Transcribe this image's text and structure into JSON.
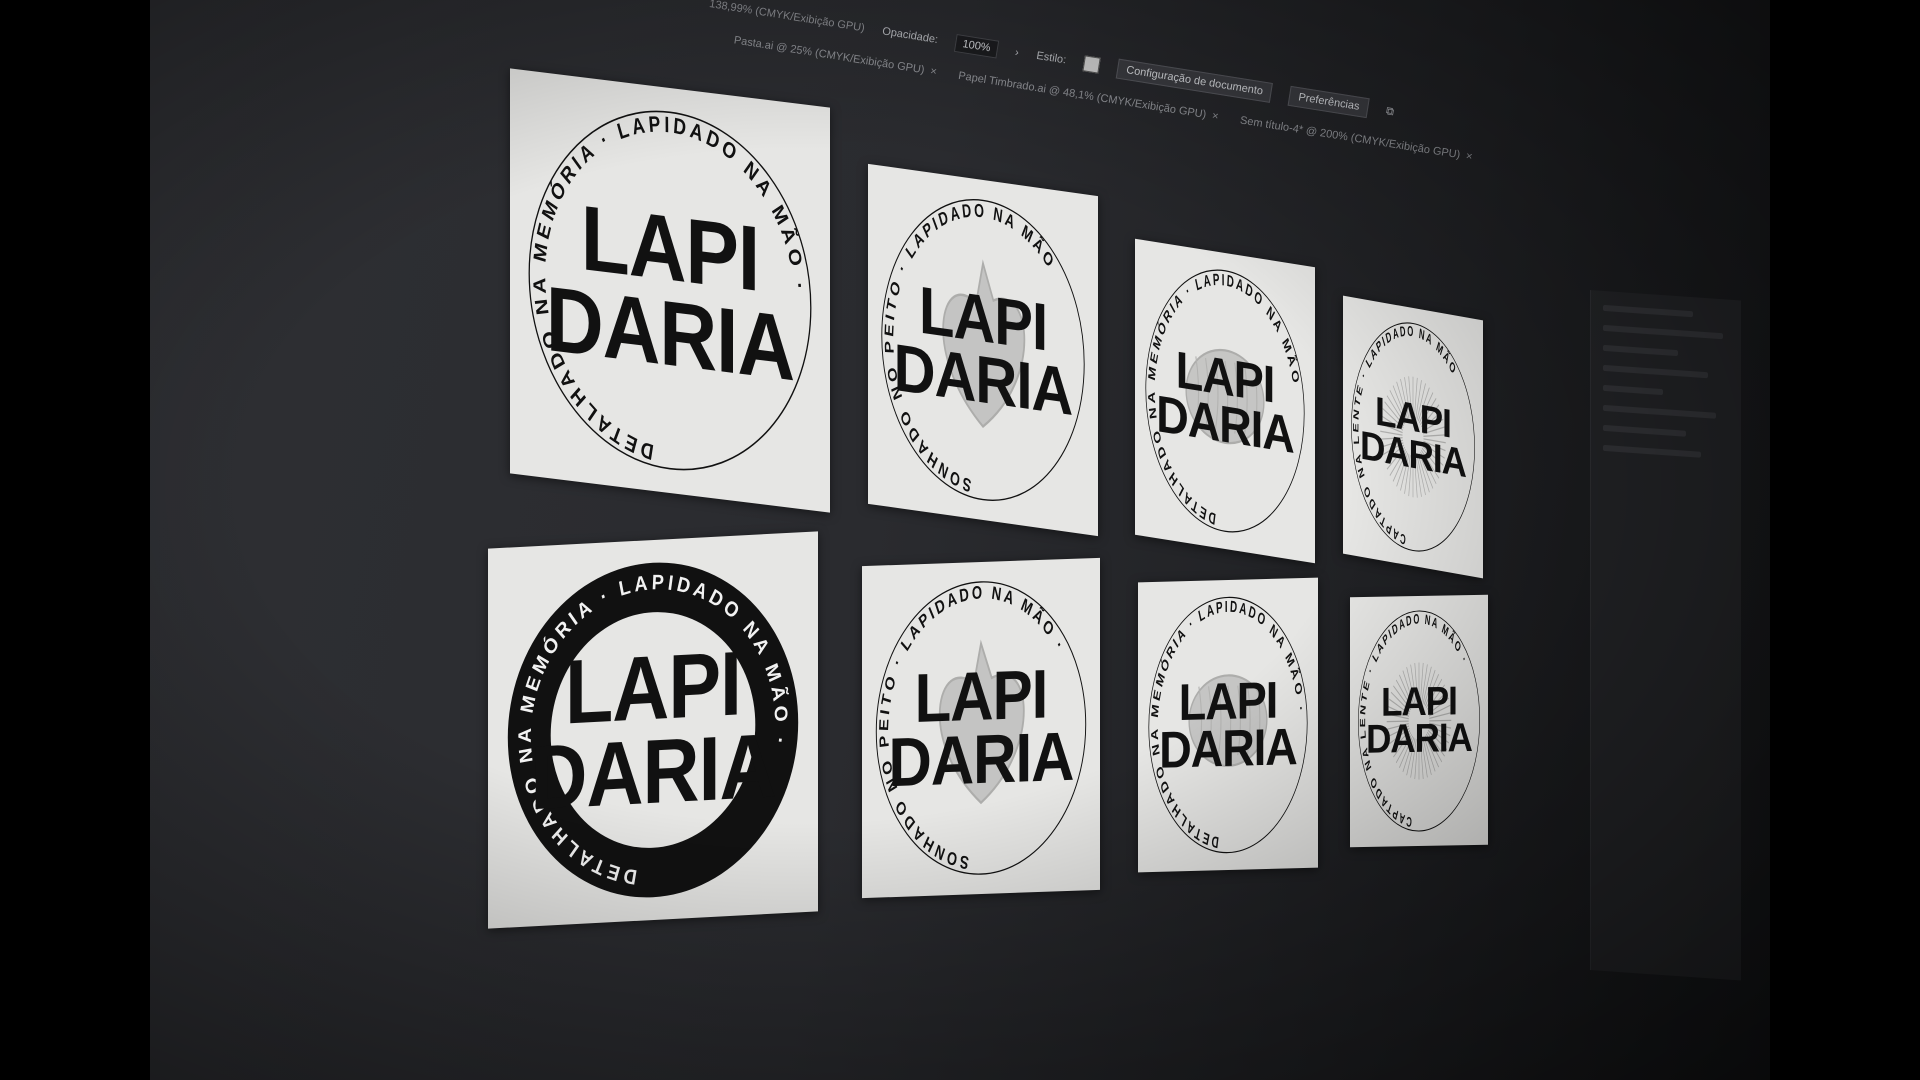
{
  "toolbar": {
    "zoom_tab": "138,99% (CMYK/Exibição GPU)",
    "opacity_label": "Opacidade:",
    "opacity_value": "100%",
    "style_label": "Estilo:",
    "doc_setup_button": "Configuração de documento",
    "preferences_button": "Preferências"
  },
  "tabs": [
    {
      "label": "Pasta.ai @ 25% (CMYK/Exibição GPU)"
    },
    {
      "label": "Papel Timbrado.ai @ 48,1% (CMYK/Exibição GPU)"
    },
    {
      "label": "Sem título-4* @ 200% (CMYK/Exibição GPU)"
    }
  ],
  "wordmark": {
    "line1": "LAPI",
    "line2": "DARIA"
  },
  "logos": [
    {
      "style": "thin-ring",
      "illustration": "none",
      "ring_text": "DETALHADO NA MEMÓRIA · LAPIDADO NA MÃO ·"
    },
    {
      "style": "thin-ring",
      "illustration": "heart-icon",
      "ring_text": "SONHADO NO PEITO · LAPIDADO NA MÃO"
    },
    {
      "style": "thin-ring",
      "illustration": "brain-icon",
      "ring_text": "DETALHADO NA MEMÓRIA · LAPIDADO NA MÃO"
    },
    {
      "style": "thin-ring",
      "illustration": "sunburst-icon",
      "ring_text": "CAPTADO NA LENTE · LAPIDADO NA MÃO"
    },
    {
      "style": "thick-ring",
      "illustration": "none",
      "ring_text": "DETALHADO NA MEMÓRIA · LAPIDADO NA MÃO ·"
    },
    {
      "style": "thin-ring",
      "illustration": "heart-icon",
      "ring_text": "SONHADO NO PEITO · LAPIDADO NA MÃO ·"
    },
    {
      "style": "thin-ring",
      "illustration": "brain-icon",
      "ring_text": "DETALHADO NA MEMÓRIA · LAPIDADO NA MÃO ·"
    },
    {
      "style": "thin-ring",
      "illustration": "sunburst-icon",
      "ring_text": "CAPTADO NA LENTE · LAPIDADO NA MÃO ·"
    }
  ],
  "colors": {
    "ink": "#111111",
    "paper": "#e6e6e4",
    "thick_ring_text": "#f2f2f2"
  }
}
